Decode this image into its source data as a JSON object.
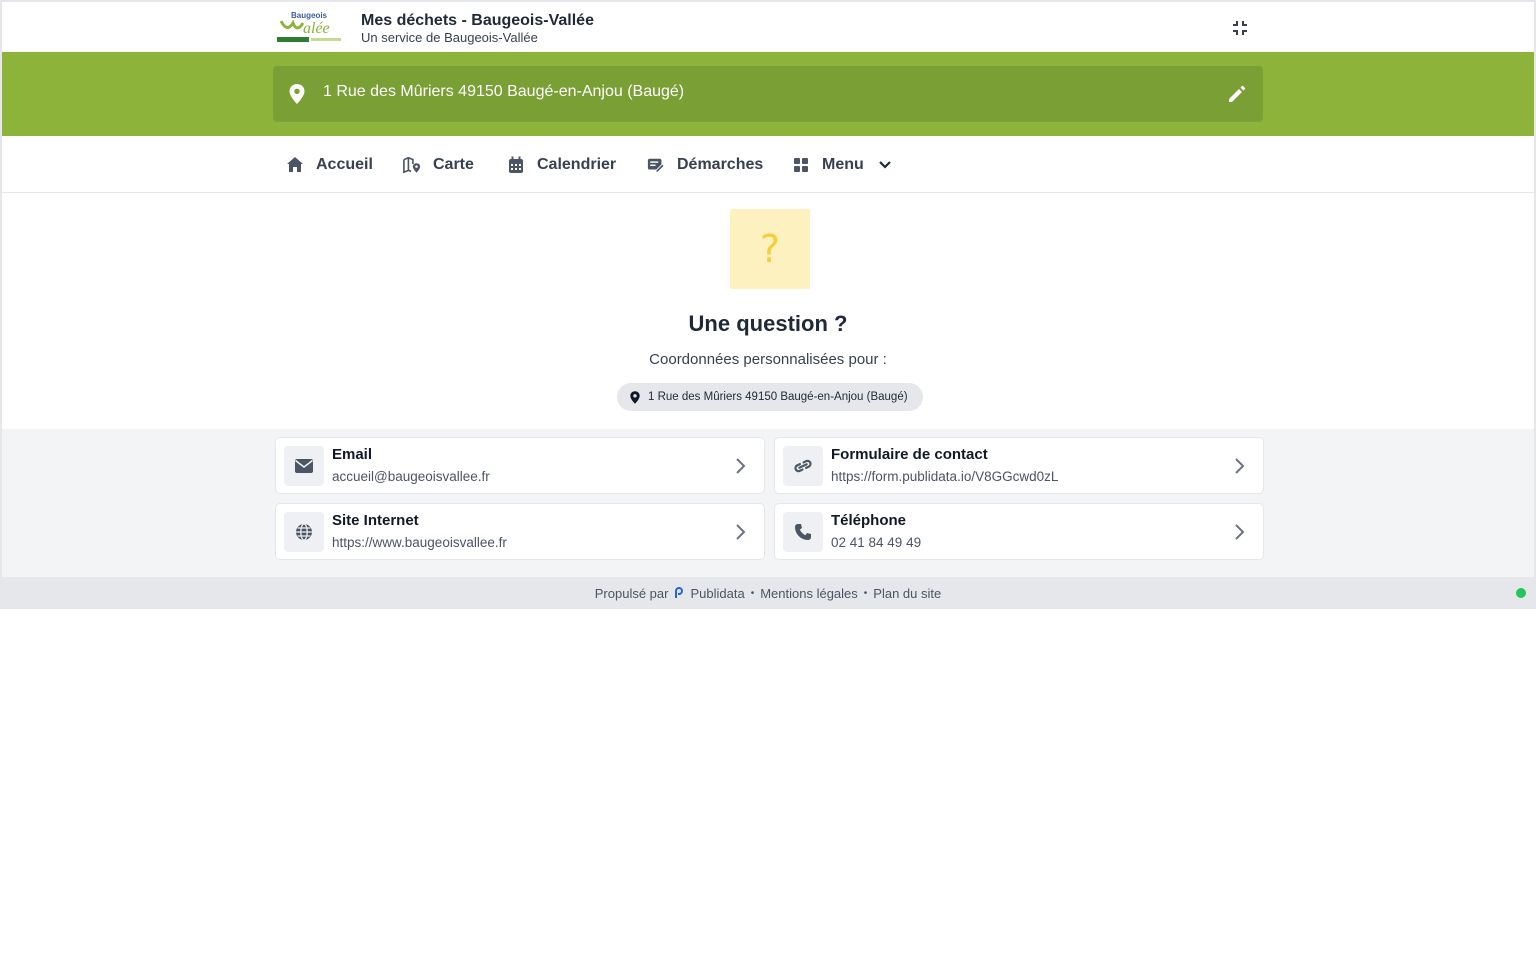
{
  "header": {
    "logo_text": "Baugeois Vallée",
    "title": "Mes déchets - Baugeois-Vallée",
    "subtitle": "Un service de Baugeois-Vallée",
    "collapse_icon": "fullscreen-exit-icon"
  },
  "address": {
    "value": "1 Rue des Mûriers 49150 Baugé-en-Anjou (Baugé)",
    "pin_icon": "map-pin-icon",
    "edit_icon": "pencil-icon"
  },
  "nav": {
    "items": [
      {
        "label": "Accueil",
        "icon": "home-icon"
      },
      {
        "label": "Carte",
        "icon": "map-marker-icon"
      },
      {
        "label": "Calendrier",
        "icon": "calendar-icon"
      },
      {
        "label": "Démarches",
        "icon": "form-edit-icon"
      },
      {
        "label": "Menu",
        "icon": "grid-icon"
      }
    ]
  },
  "hero": {
    "icon": "question-mark-icon",
    "title": "Une question ?",
    "subtitle": "Coordonnées personnalisées pour :",
    "address_chip": "1 Rue des Mûriers 49150 Baugé-en-Anjou (Baugé)"
  },
  "contacts": [
    {
      "title": "Email",
      "value": "accueil@baugeoisvallee.fr",
      "icon": "envelope-icon"
    },
    {
      "title": "Formulaire de contact",
      "value": "https://form.publidata.io/V8GGcwd0zL",
      "icon": "link-icon"
    },
    {
      "title": "Site Internet",
      "value": "https://www.baugeoisvallee.fr",
      "icon": "globe-icon"
    },
    {
      "title": "Téléphone",
      "value": "02 41 84 49 49",
      "icon": "phone-icon"
    }
  ],
  "footer": {
    "powered_by": "Propulsé par",
    "brand": "Publidata",
    "legal": "Mentions légales",
    "sitemap": "Plan du site",
    "separator": "•"
  },
  "colors": {
    "brand_green": "#8db33a",
    "address_bar": "#7a9f34",
    "question_bg": "#fdf1c0",
    "question_fg": "#f5cf3a",
    "status_online": "#22c55e"
  }
}
